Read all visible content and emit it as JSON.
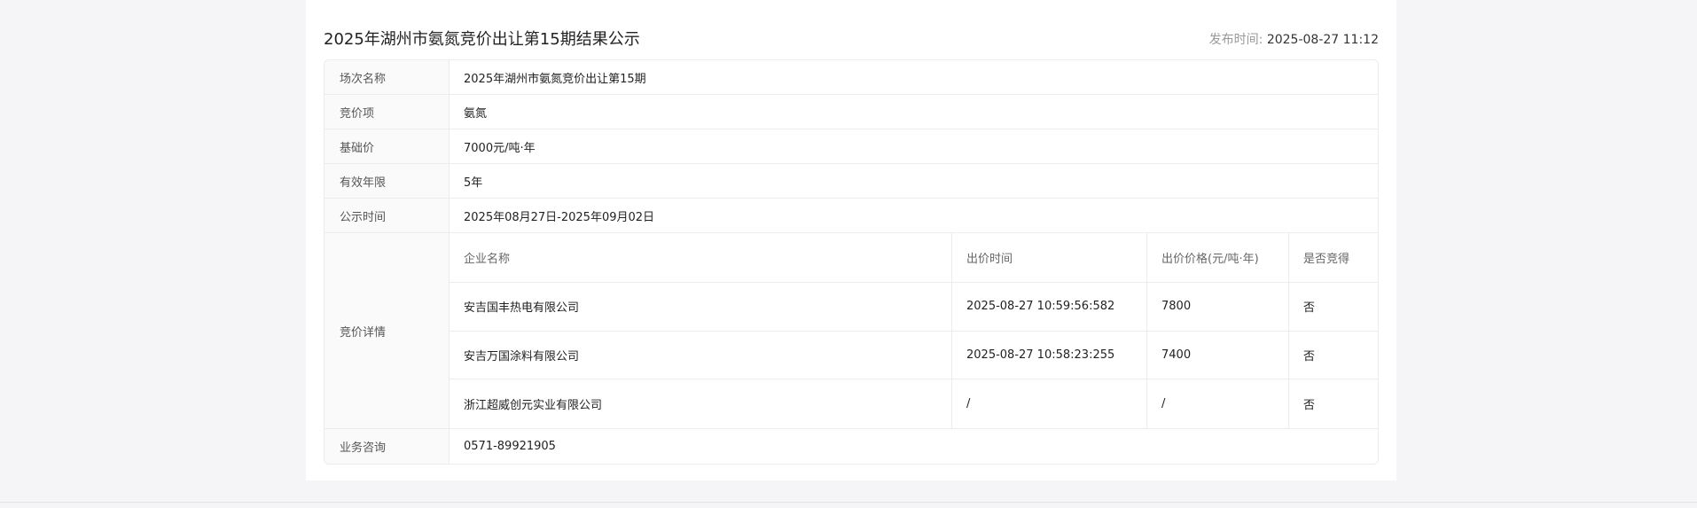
{
  "header": {
    "title": "2025年湖州市氨氮竞价出让第15期结果公示",
    "publish_label": "发布时间:",
    "publish_time": "2025-08-27 11:12"
  },
  "info": {
    "session_label": "场次名称",
    "session_value": "2025年湖州市氨氮竞价出让第15期",
    "item_label": "竞价项",
    "item_value": "氨氮",
    "base_price_label": "基础价",
    "base_price_value": "7000元/吨·年",
    "validity_label": "有效年限",
    "validity_value": "5年",
    "notice_label": "公示时间",
    "notice_value": "2025年08月27日-2025年09月02日",
    "detail_label": "竞价详情",
    "consult_label": "业务咨询",
    "consult_value": "0571-89921905"
  },
  "bids": {
    "columns": [
      "企业名称",
      "出价时间",
      "出价价格(元/吨·年)",
      "是否竞得"
    ],
    "rows": [
      [
        "安吉国丰热电有限公司",
        "2025-08-27 10:59:56:582",
        "7800",
        "否"
      ],
      [
        "安吉万国涂料有限公司",
        "2025-08-27 10:58:23:255",
        "7400",
        "否"
      ],
      [
        "浙江超威创元实业有限公司",
        "/",
        "/",
        "否"
      ]
    ]
  }
}
